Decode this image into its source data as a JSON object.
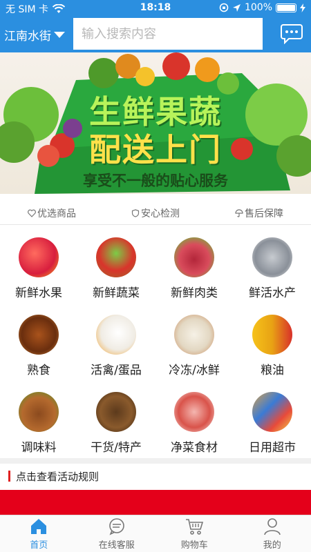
{
  "status": {
    "carrier": "无 SIM 卡",
    "time": "18:18",
    "battery": "100%"
  },
  "header": {
    "location": "江南水街",
    "search_placeholder": "输入搜索内容"
  },
  "banner": {
    "title_line1": "生鲜果蔬",
    "title_line2": "配送上门",
    "subtitle": "享受不一般的贴心服务"
  },
  "features": [
    "优选商品",
    "安心检测",
    "售后保障"
  ],
  "categories": [
    {
      "label": "新鲜水果",
      "icon": "fruit-icon"
    },
    {
      "label": "新鲜蔬菜",
      "icon": "vegetable-icon"
    },
    {
      "label": "新鲜肉类",
      "icon": "meat-icon"
    },
    {
      "label": "鲜活水产",
      "icon": "fish-icon"
    },
    {
      "label": "熟食",
      "icon": "cooked-food-icon"
    },
    {
      "label": "活禽/蛋品",
      "icon": "poultry-icon"
    },
    {
      "label": "冷冻/冰鲜",
      "icon": "frozen-icon"
    },
    {
      "label": "粮油",
      "icon": "oil-icon"
    },
    {
      "label": "调味料",
      "icon": "spice-icon"
    },
    {
      "label": "干货/特产",
      "icon": "dried-goods-icon"
    },
    {
      "label": "净菜食材",
      "icon": "prepared-veg-icon"
    },
    {
      "label": "日用超市",
      "icon": "supermarket-icon"
    }
  ],
  "rules_link": "点击查看活动规则",
  "tabs": [
    {
      "label": "首页",
      "icon": "home-icon"
    },
    {
      "label": "在线客服",
      "icon": "chat-icon"
    },
    {
      "label": "购物车",
      "icon": "cart-icon"
    },
    {
      "label": "我的",
      "icon": "user-icon"
    }
  ],
  "colors": {
    "primary": "#2b8fe0",
    "banner_green": "#2aa83e",
    "accent_red": "#e4001a"
  }
}
